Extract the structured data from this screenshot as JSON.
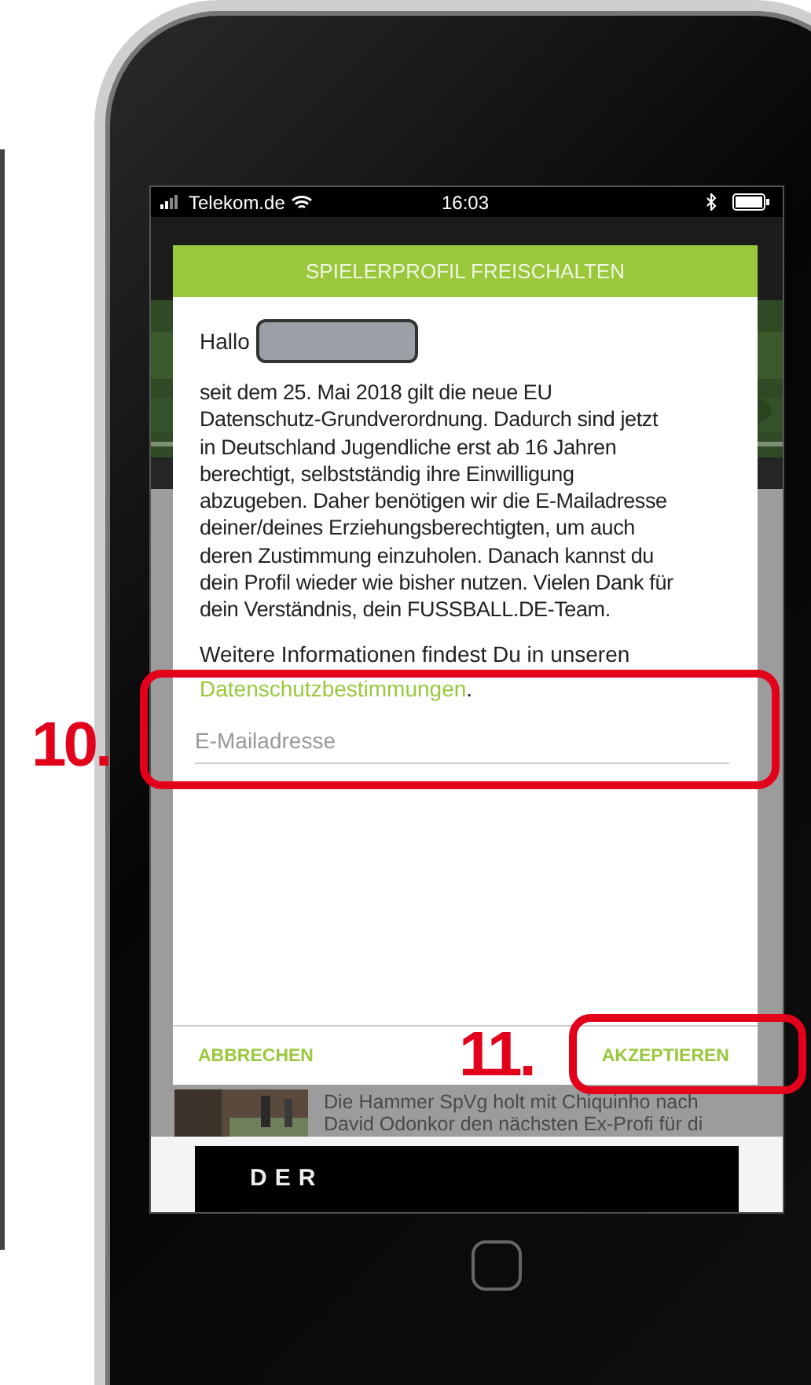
{
  "status_bar": {
    "carrier": "Telekom.de",
    "time": "16:03"
  },
  "dialog": {
    "title": "SPIELERPROFIL FREISCHALTEN",
    "greeting": "Hallo",
    "body_lines": [
      "seit dem 25. Mai 2018 gilt die neue EU",
      "Datenschutz-Grundverordnung. Dadurch sind jetzt",
      "in Deutschland Jugendliche erst ab 16 Jahren",
      "berechtigt, selbstständig ihre Einwilligung",
      "abzugeben. Daher benötigen wir die E-Mailadresse",
      "deiner/deines Erziehungsberechtigten, um auch",
      "deren Zustimmung einzuholen. Danach kannst du",
      "dein Profil wieder wie bisher nutzen. Vielen Dank für",
      "dein Verständnis, dein FUSSBALL.DE-Team."
    ],
    "more_info": "Weitere Informationen findest Du in unseren",
    "link": "Datenschutzbestimmungen",
    "link_suffix": ".",
    "email_field": {
      "placeholder": "E-Mailadresse"
    },
    "buttons": [
      {
        "label": "ABBRECHEN"
      },
      {
        "label": "AKZEPTIEREN"
      }
    ]
  },
  "news_item": {
    "lines": [
      "Die Hammer SpVg holt mit Chiquinho nach",
      "David Odonkor den nächsten Ex-Profi für di"
    ]
  },
  "ad": {
    "text": "DER"
  },
  "annotations": [
    {
      "label": "10."
    },
    {
      "label": "11."
    }
  ]
}
